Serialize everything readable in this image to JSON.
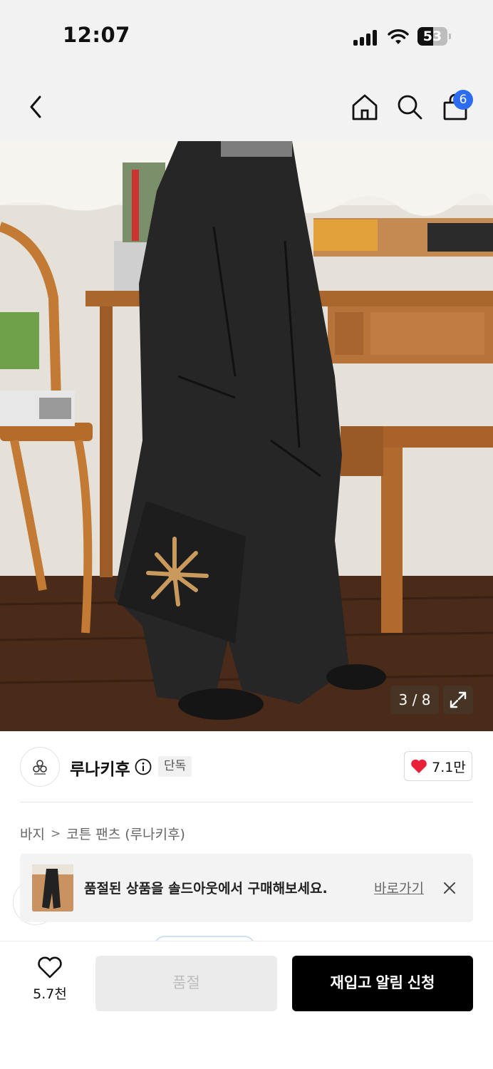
{
  "status_bar": {
    "time": "12:07",
    "battery_level": "53",
    "icons": [
      "signal-icon",
      "wifi-icon",
      "battery-icon"
    ]
  },
  "header": {
    "icons": [
      "back-arrow-icon",
      "home-icon",
      "search-icon",
      "shopping-bag-icon"
    ],
    "cart_count": "6"
  },
  "gallery": {
    "counter": "3 / 8",
    "current_index": 3,
    "total": 8,
    "zoom_icon": "expand-icon"
  },
  "brand": {
    "name": "루나키후",
    "badge": "단독",
    "like_count": "7.1만"
  },
  "breadcrumb": {
    "items": [
      "바지",
      "코튼 팬츠 (루나키후)"
    ],
    "separator": ">"
  },
  "soldout_banner": {
    "text": "품절된 상품을 솔드아웃에서 구매해보세요.",
    "link": "바로가기"
  },
  "bottom_bar": {
    "wish_count": "5.7천",
    "soldout_label": "품절",
    "restock_label": "재입고 알림 신청"
  },
  "colors": {
    "accent_badge": "#2d6cf0",
    "heart": "#e8203a",
    "primary_button": "#000000",
    "disabled_button": "#ebebeb"
  }
}
